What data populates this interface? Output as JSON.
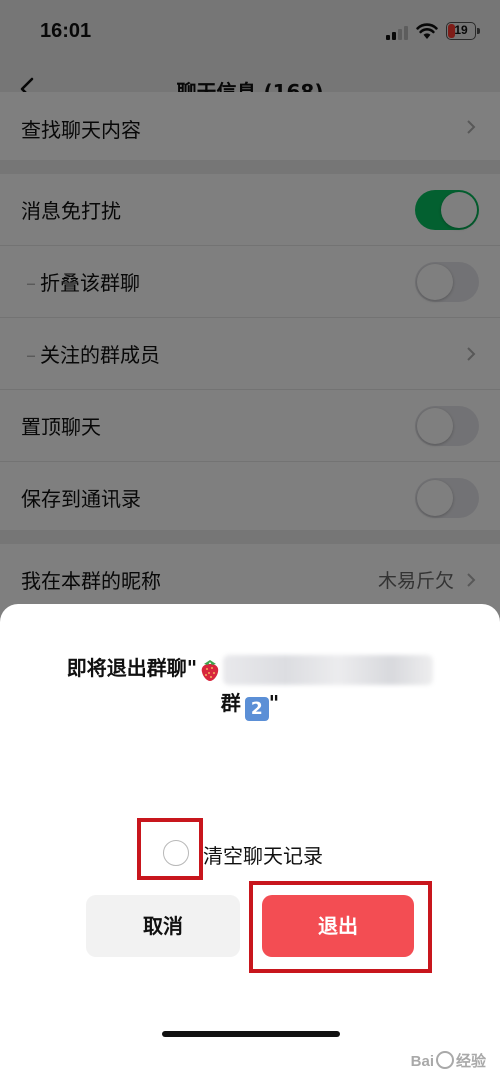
{
  "status_bar": {
    "time": "16:01",
    "battery": "19"
  },
  "nav": {
    "title": "聊天信息 (168)"
  },
  "settings": {
    "search_chat": "查找聊天内容",
    "do_not_disturb": {
      "label": "消息免打扰",
      "on": true
    },
    "fold_group": {
      "label": "折叠该群聊",
      "on": false
    },
    "followed_members": {
      "label": "关注的群成员"
    },
    "pin_chat": {
      "label": "置顶聊天",
      "on": false
    },
    "save_contacts": {
      "label": "保存到通讯录",
      "on": false
    },
    "nickname": {
      "label": "我在本群的昵称",
      "value": "木易斤欠"
    }
  },
  "dialog": {
    "message_prefix": "即将退出群聊\"",
    "message_line2": "群",
    "badge_number": "2",
    "message_suffix": "\"",
    "clear_history_label": "清空聊天记录",
    "clear_history_checked": false,
    "cancel_label": "取消",
    "exit_label": "退出"
  },
  "watermark": {
    "text_left": "Bai",
    "text_right": "经验"
  },
  "colors": {
    "accent_green": "#07c160",
    "exit_red": "#f34d53",
    "highlight_red": "#c8161d"
  }
}
